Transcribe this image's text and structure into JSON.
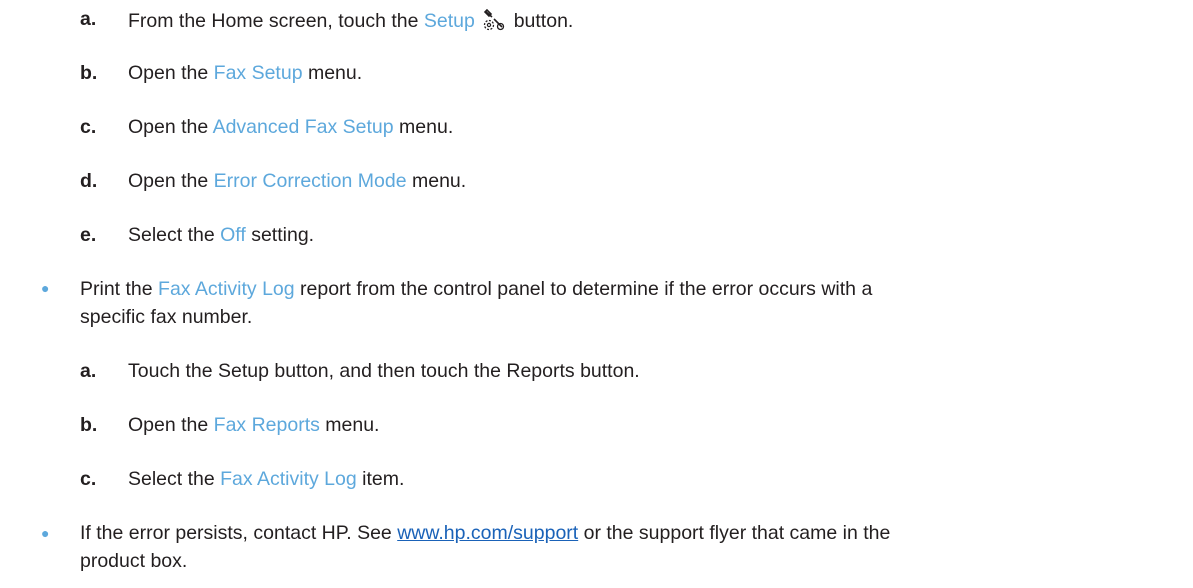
{
  "steps_a": [
    {
      "letter": "a.",
      "pre": "From the Home screen, touch the ",
      "ui": "Setup",
      "post": " button.",
      "icon": "setup-tool-icon"
    },
    {
      "letter": "b.",
      "pre": "Open the ",
      "ui": "Fax Setup",
      "post": " menu."
    },
    {
      "letter": "c.",
      "pre": "Open the ",
      "ui": "Advanced Fax Setup",
      "post": " menu."
    },
    {
      "letter": "d.",
      "pre": "Open the ",
      "ui": "Error Correction Mode",
      "post": " menu."
    },
    {
      "letter": "e.",
      "pre": "Select the ",
      "ui": "Off",
      "post": " setting."
    }
  ],
  "bullet1": {
    "pre": "Print the ",
    "ui": "Fax Activity Log",
    "post": " report from the control panel to determine if the error occurs with a",
    "line2": "specific fax number."
  },
  "steps_b": [
    {
      "letter": "a.",
      "text": "Touch the Setup button, and then touch the Reports button."
    },
    {
      "letter": "b.",
      "pre": "Open the ",
      "ui": "Fax Reports",
      "post": " menu."
    },
    {
      "letter": "c.",
      "pre": "Select the ",
      "ui": "Fax Activity Log",
      "post": " item."
    }
  ],
  "bullet2": {
    "pre": "If the error persists, contact HP. See ",
    "link": "www.hp.com/support",
    "post": " or the support flyer that came in the",
    "line2": "product box."
  },
  "colors": {
    "ui_text": "#5da8dc",
    "link": "#1a62b8",
    "body_text": "#231f20"
  }
}
